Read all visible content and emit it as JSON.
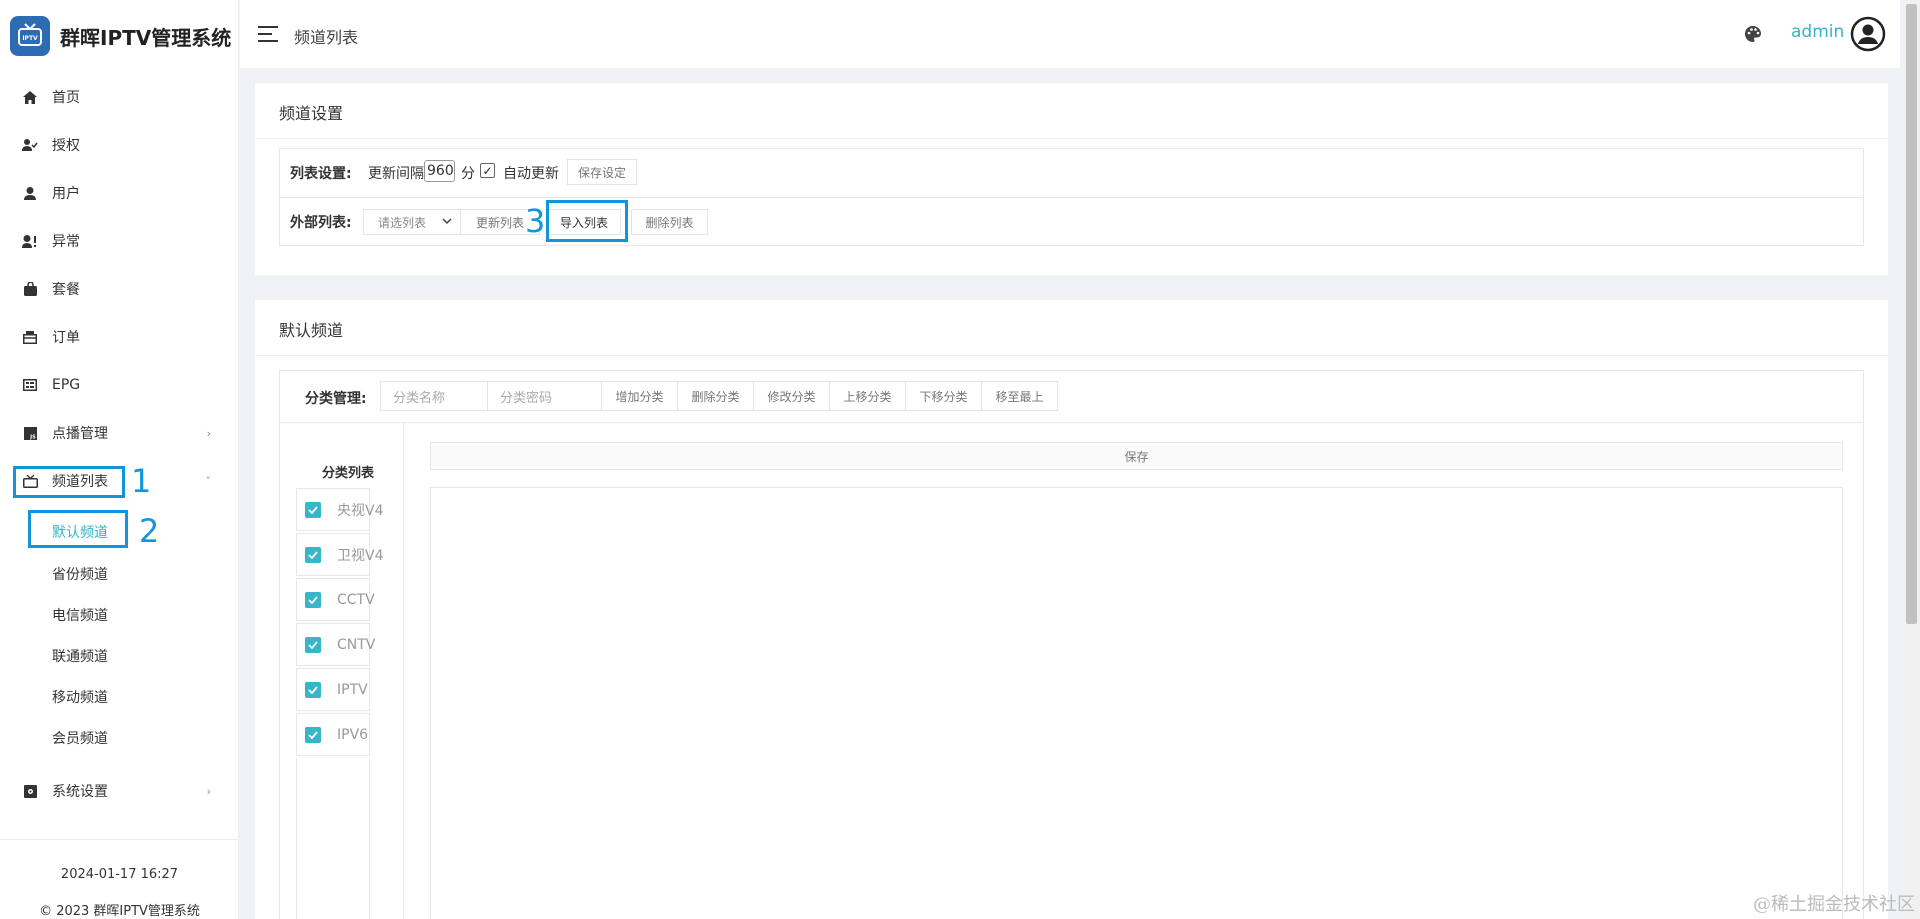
{
  "brand": {
    "title": "群晖IPTV管理系统",
    "logo_text": "IPTV"
  },
  "sidebar": {
    "items": [
      {
        "label": "首页",
        "icon": "home-icon"
      },
      {
        "label": "授权",
        "icon": "user-check-icon"
      },
      {
        "label": "用户",
        "icon": "user-icon"
      },
      {
        "label": "异常",
        "icon": "user-alert-icon"
      },
      {
        "label": "套餐",
        "icon": "bag-icon"
      },
      {
        "label": "订单",
        "icon": "order-icon"
      },
      {
        "label": "EPG",
        "icon": "epg-icon"
      },
      {
        "label": "点播管理",
        "icon": "js-icon",
        "arrow": "›"
      },
      {
        "label": "频道列表",
        "icon": "tv-icon",
        "arrow": "ˇ"
      },
      {
        "label": "系统设置",
        "icon": "settings-icon",
        "arrow": "›"
      }
    ],
    "subitems": [
      "默认频道",
      "省份频道",
      "电信频道",
      "联通频道",
      "移动频道",
      "会员频道"
    ],
    "footer_time": "2024-01-17 16:27",
    "footer_copy": "© 2023 群晖IPTV管理系统"
  },
  "annotations": [
    "1",
    "2",
    "3"
  ],
  "header": {
    "title": "频道列表",
    "user": "admin"
  },
  "channel_settings": {
    "title": "频道设置",
    "list_label": "列表设置:",
    "interval_label": "更新间隔",
    "interval_value": "960",
    "interval_unit": "分",
    "auto_checked": "✓",
    "auto_label": "自动更新",
    "save_setting": "保存设定",
    "external_label": "外部列表:",
    "select_placeholder": "请选列表",
    "update_list": "更新列表",
    "import_list": "导入列表",
    "delete_list": "删除列表"
  },
  "default_channels": {
    "title": "默认频道",
    "cat_mgmt_label": "分类管理:",
    "cat_name_placeholder": "分类名称",
    "cat_pwd_placeholder": "分类密码",
    "buttons": [
      "增加分类",
      "删除分类",
      "修改分类",
      "上移分类",
      "下移分类",
      "移至最上"
    ],
    "cat_list_title": "分类列表",
    "categories": [
      "央视V4",
      "卫视V4",
      "CCTV",
      "CNTV",
      "IPTV",
      "IPV6"
    ],
    "save": "保存"
  },
  "watermark": "@稀土掘金技术社区",
  "colors": {
    "accent": "#30b4c6",
    "annotation": "#1296db",
    "check": "#36b6c8"
  }
}
